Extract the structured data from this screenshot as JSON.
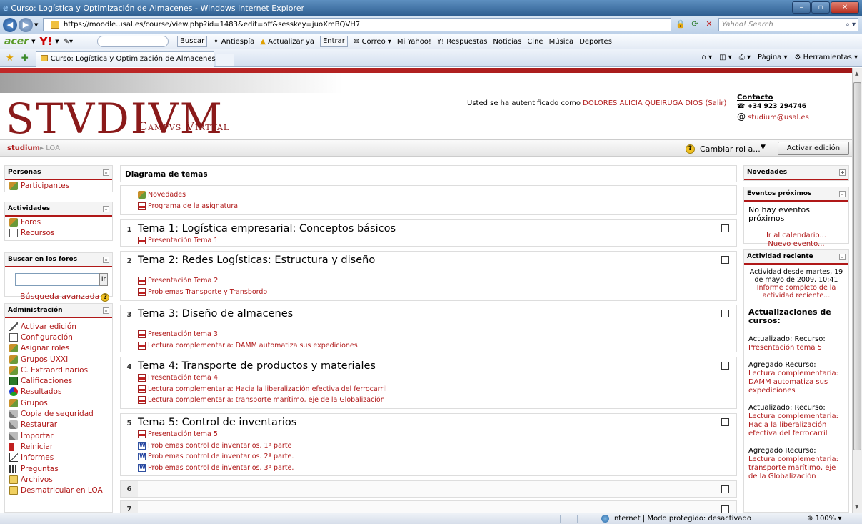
{
  "window": {
    "title": "Curso: Logística y Optimización de Almacenes - Windows Internet Explorer"
  },
  "address": {
    "url": "https://moodle.usal.es/course/view.php?id=1483&edit=off&sesskey=juoXmBQVH7",
    "search_placeholder": "Yahoo! Search"
  },
  "toolbar": {
    "brand": "acer",
    "yahoo": "Y!",
    "buscar": "Buscar",
    "antiespia": "Antiespía",
    "actualizar": "Actualizar ya",
    "entrar": "Entrar",
    "correo": "Correo",
    "mi_yahoo": "Mi Yahoo!",
    "respuestas": "Y! Respuestas",
    "noticias": "Noticias",
    "cine": "Cine",
    "musica": "Música",
    "deportes": "Deportes"
  },
  "favbar": {
    "tab_label": "Curso: Logística y Optimización de Almacenes",
    "pagina": "Página",
    "herramientas": "Herramientas"
  },
  "banner": {
    "logo": "STVDIVM",
    "logo_sub": "Campvs Virtval",
    "auth_prefix": "Usted se ha autentificado como",
    "auth_user": "DOLORES ALICIA QUEIRUGA DIOS",
    "auth_logout": "(Salir)",
    "contact_title": "Contacto",
    "contact_phone": "+34 923 294746",
    "contact_email": "studium@usal.es"
  },
  "nav": {
    "home": "studium",
    "current": "LOA",
    "role_label": "Cambiar rol a...",
    "edit_button": "Activar edición"
  },
  "left": {
    "personas": {
      "title": "Personas",
      "items": [
        "Participantes"
      ]
    },
    "actividades": {
      "title": "Actividades",
      "items": [
        "Foros",
        "Recursos"
      ]
    },
    "buscar": {
      "title": "Buscar en los foros",
      "go": "Ir",
      "advanced": "Búsqueda avanzada"
    },
    "admin": {
      "title": "Administración",
      "items": [
        "Activar edición",
        "Configuración",
        "Asignar roles",
        "Grupos UXXI",
        "C. Extraordinarios",
        "Calificaciones",
        "Resultados",
        "Grupos",
        "Copia de seguridad",
        "Restaurar",
        "Importar",
        "Reiniciar",
        "Informes",
        "Preguntas",
        "Archivos",
        "Desmatricular en LOA"
      ]
    }
  },
  "main": {
    "header": "Diagrama de temas",
    "intro": [
      "Novedades",
      "Programa de la asignatura"
    ],
    "topics": [
      {
        "num": "1",
        "title": "Tema 1: Logística empresarial: Conceptos básicos",
        "resources": [
          "Presentación Tema 1"
        ]
      },
      {
        "num": "2",
        "title": "Tema 2: Redes Logísticas: Estructura y diseño",
        "resources": [
          "Presentación Tema 2",
          "Problemas Transporte y Transbordo"
        ]
      },
      {
        "num": "3",
        "title": "Tema 3: Diseño de almacenes",
        "resources": [
          "Presentación tema 3",
          "Lectura complementaria: DAMM automatiza sus expediciones"
        ]
      },
      {
        "num": "4",
        "title": "Tema 4: Transporte de productos y materiales",
        "resources": [
          "Presentación tema 4",
          "Lectura complementaria: Hacia la liberalización efectiva del ferrocarril",
          "Lectura complementaria: transporte marítimo, eje de la Globalización"
        ]
      },
      {
        "num": "5",
        "title": "Tema 5: Control de inventarios",
        "resources": [
          "Presentación tema 5",
          "Problemas control de inventarios. 1ª parte",
          "Problemas control de inventarios. 2ª parte.",
          "Problemas control de inventarios. 3ª parte."
        ]
      },
      {
        "num": "6"
      },
      {
        "num": "7"
      }
    ]
  },
  "right": {
    "novedades": {
      "title": "Novedades"
    },
    "eventos": {
      "title": "Eventos próximos",
      "empty": "No hay eventos próximos",
      "calendar": "Ir al calendario...",
      "new_event": "Nuevo evento..."
    },
    "reciente": {
      "title": "Actividad reciente",
      "since": "Actividad desde martes, 19 de mayo de 2009, 10:41",
      "report": "Informe completo de la actividad reciente...",
      "updates_title": "Actualizaciones de cursos:",
      "updates": [
        {
          "action": "Actualizado: Recurso:",
          "item": "Presentación tema 5"
        },
        {
          "action": "Agregado Recurso:",
          "item": "Lectura complementaria: DAMM automatiza sus expediciones"
        },
        {
          "action": "Actualizado: Recurso:",
          "item": "Lectura complementaria: Hacia la liberalización efectiva del ferrocarril"
        },
        {
          "action": "Agregado Recurso:",
          "item": "Lectura complementaria: transporte marítimo, eje de la Globalización"
        }
      ]
    }
  },
  "status": {
    "zone": "Internet | Modo protegido: desactivado",
    "zoom": "100%"
  }
}
